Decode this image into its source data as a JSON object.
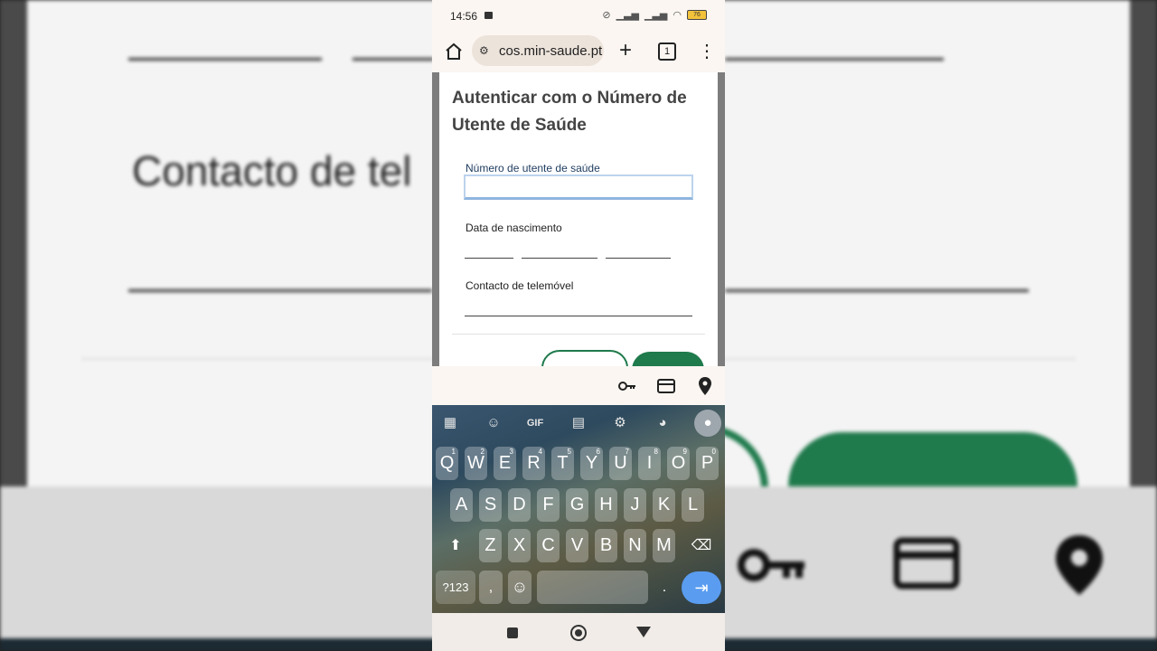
{
  "status_bar": {
    "time": "14:56",
    "battery": "76"
  },
  "browser": {
    "url": "cos.min-saude.pt",
    "tab_count": "1"
  },
  "form": {
    "title": "Autenticar com o Número de Utente de Saúde",
    "nus_label": "Número de utente de saúde",
    "dob_label": "Data de nascimento",
    "phone_label": "Contacto de telemóvel"
  },
  "background": {
    "zoom_text": "Contacto de tel"
  },
  "keyboard": {
    "toolbar": {
      "gif_label": "GIF"
    },
    "row1": [
      {
        "k": "Q",
        "n": "1"
      },
      {
        "k": "W",
        "n": "2"
      },
      {
        "k": "E",
        "n": "3"
      },
      {
        "k": "R",
        "n": "4"
      },
      {
        "k": "T",
        "n": "5"
      },
      {
        "k": "Y",
        "n": "6"
      },
      {
        "k": "U",
        "n": "7"
      },
      {
        "k": "I",
        "n": "8"
      },
      {
        "k": "O",
        "n": "9"
      },
      {
        "k": "P",
        "n": "0"
      }
    ],
    "row2": [
      "A",
      "S",
      "D",
      "F",
      "G",
      "H",
      "J",
      "K",
      "L"
    ],
    "row3": [
      "Z",
      "X",
      "C",
      "V",
      "B",
      "N",
      "M"
    ],
    "symbols_label": "?123",
    "comma": ",",
    "period": "."
  }
}
